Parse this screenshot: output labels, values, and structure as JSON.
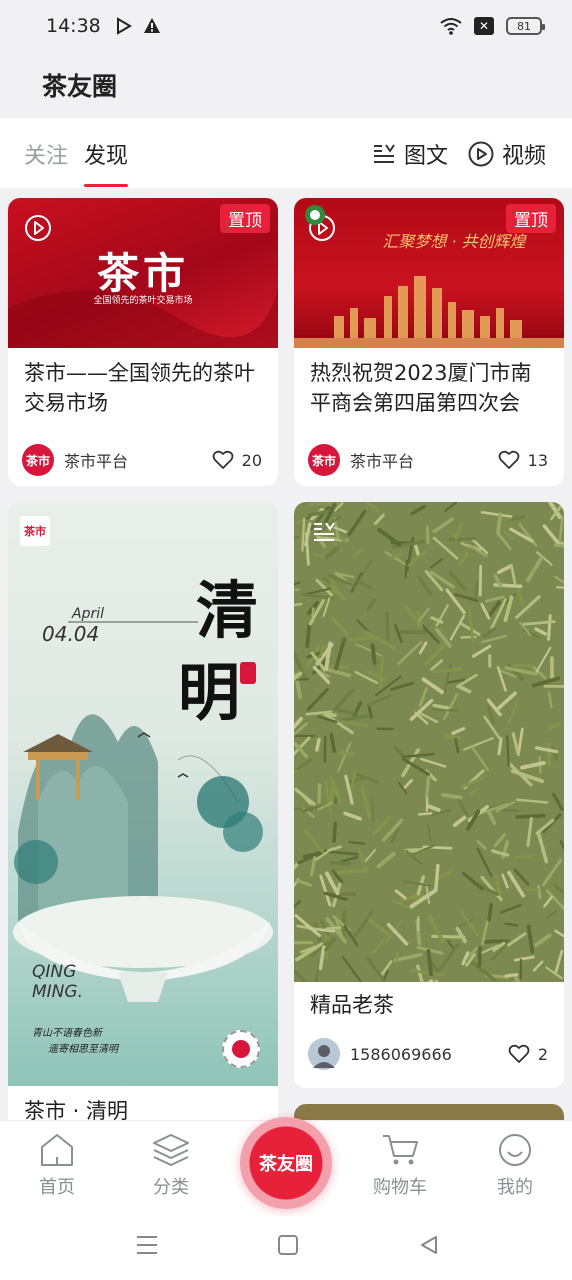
{
  "status": {
    "time": "14:38",
    "battery": "81"
  },
  "app": {
    "title": "茶友圈"
  },
  "tabs": {
    "follow": "关注",
    "discover": "发现"
  },
  "filters": {
    "image_text": "图文",
    "video": "视频"
  },
  "cards": [
    {
      "title": "茶市——全国领先的茶叶交易市场",
      "pin": "置顶",
      "cover_heading": "茶市",
      "cover_sub": "全国领先的茶叶交易市场",
      "author": "茶市平台",
      "avatar_text": "茶市",
      "likes": "20"
    },
    {
      "title": "热烈祝贺2023厦门市南平商会第四届第四次会",
      "pin": "置顶",
      "cover_heading": "汇聚梦想 · 共创辉煌",
      "author": "茶市平台",
      "avatar_text": "茶市",
      "likes": "13"
    },
    {
      "title": "茶市 · 清明",
      "cover_month": "April",
      "cover_date": "04.04",
      "cover_glyph_1": "清",
      "cover_glyph_2": "明",
      "cover_brand": "茶市",
      "cover_en": "QING MING.",
      "cover_line1": "青山不语春色新",
      "cover_line2": "遥寄相思至清明"
    },
    {
      "title": "精品老茶",
      "author": "1586069666",
      "likes": "2"
    }
  ],
  "nav": {
    "home": "首页",
    "category": "分类",
    "center": "茶友圈",
    "cart": "购物车",
    "mine": "我的"
  },
  "colors": {
    "accent": "#e8213a",
    "background": "#f1f1f3"
  }
}
